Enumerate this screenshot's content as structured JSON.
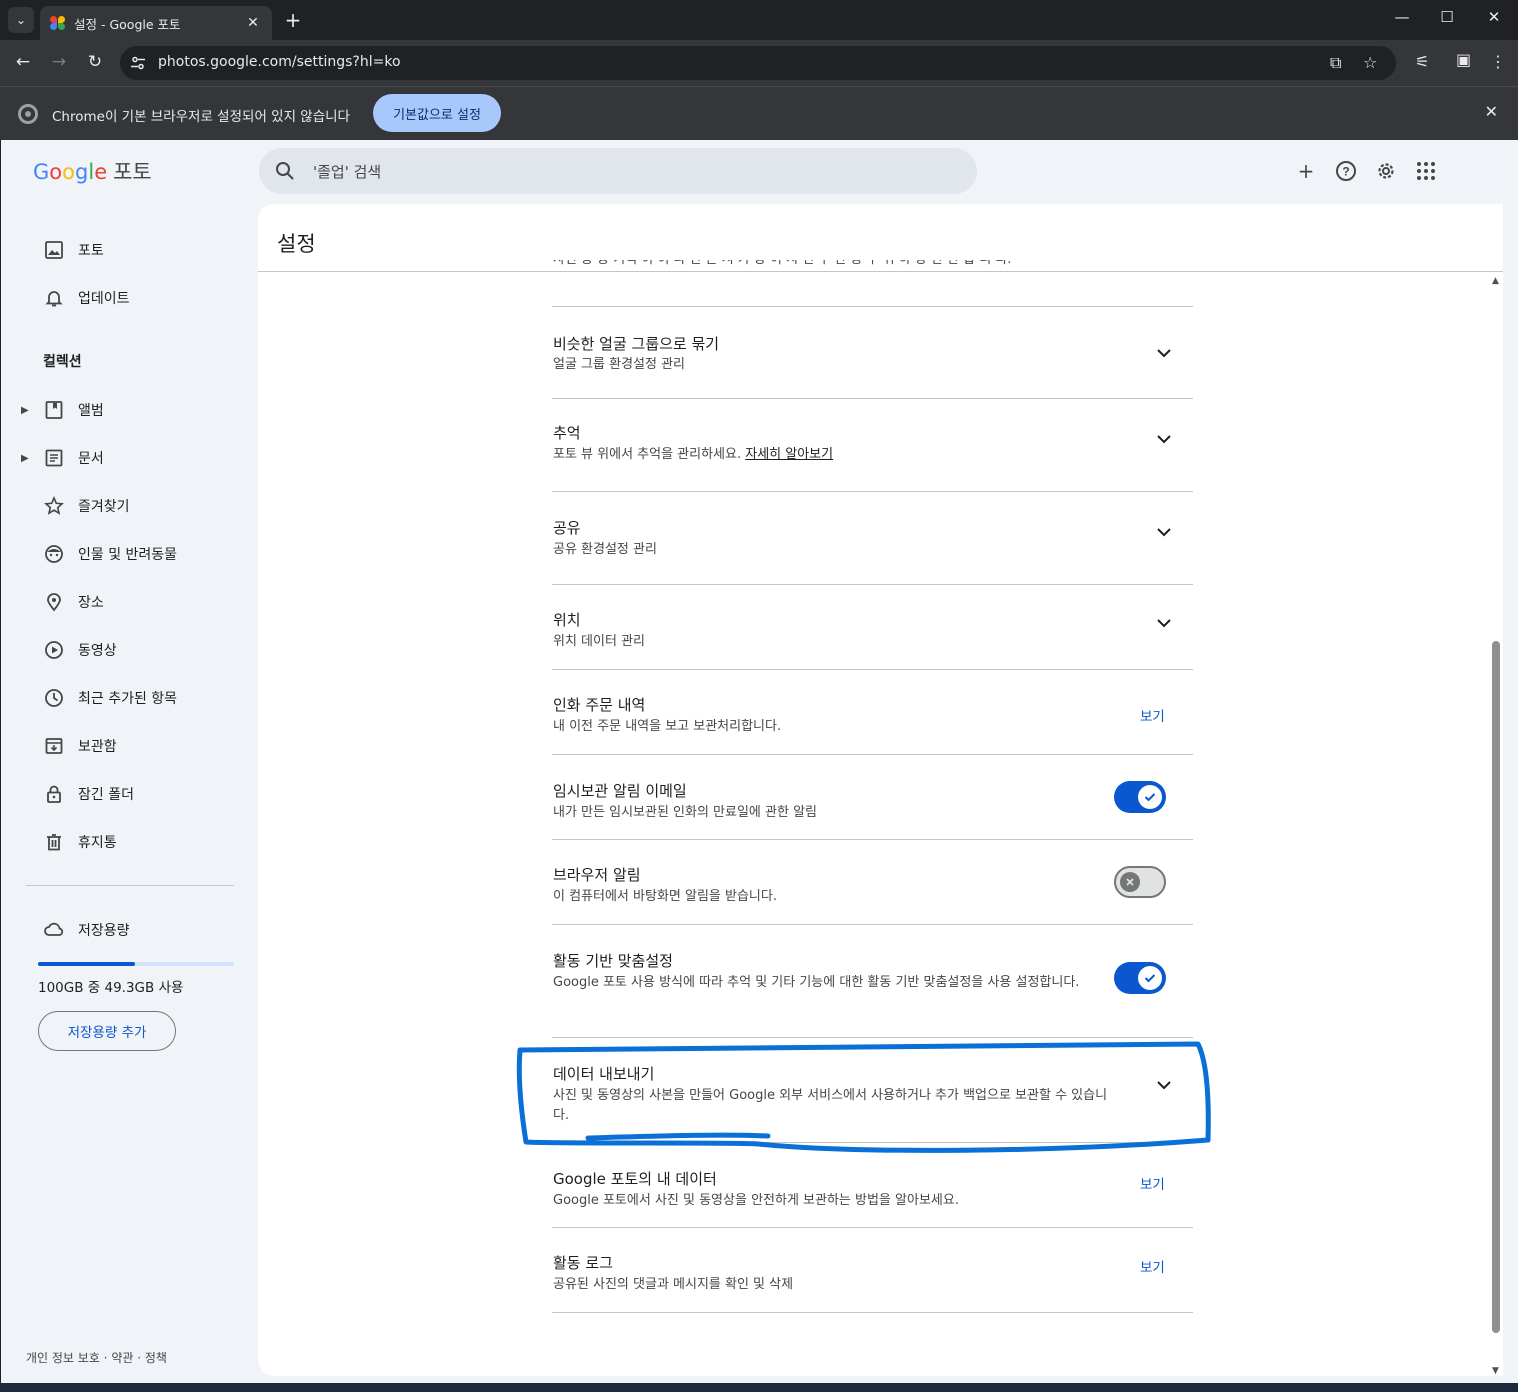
{
  "browser": {
    "tab_title": "설정 - Google 포토",
    "new_tab": "+",
    "url": "photos.google.com/settings?hl=ko",
    "infobar_message": "Chrome이 기본 브라우저로 설정되어 있지 않습니다",
    "infobar_button": "기본값으로 설정"
  },
  "app": {
    "logo_google": [
      "G",
      "o",
      "o",
      "g",
      "l",
      "e"
    ],
    "logo_product": "포토",
    "search_placeholder": "'졸업' 검색"
  },
  "sidebar": {
    "items": [
      {
        "label": "포토",
        "icon": "photo-icon"
      },
      {
        "label": "업데이트",
        "icon": "bell-icon"
      }
    ],
    "collections_heading": "컬렉션",
    "collections": [
      {
        "label": "앨범",
        "icon": "album-icon"
      },
      {
        "label": "문서",
        "icon": "document-icon"
      },
      {
        "label": "즐겨찾기",
        "icon": "star-icon"
      },
      {
        "label": "인물 및 반려동물",
        "icon": "face-icon"
      },
      {
        "label": "장소",
        "icon": "location-icon"
      },
      {
        "label": "동영상",
        "icon": "play-icon"
      },
      {
        "label": "최근 추가된 항목",
        "icon": "clock-icon"
      },
      {
        "label": "보관함",
        "icon": "archive-icon"
      },
      {
        "label": "잠긴 폴더",
        "icon": "lock-icon"
      },
      {
        "label": "휴지통",
        "icon": "trash-icon"
      }
    ],
    "storage": {
      "label": "저장용량",
      "usage_text": "100GB 중 49.3GB 사용",
      "used_fraction": 0.493,
      "button": "저장용량 추가"
    },
    "footer": "개인 정보 보호 · 약관 · 정책"
  },
  "settings": {
    "title": "설정",
    "cut_text": "사진 중 등 기억 이 이 나 만 는 시 가 당 이 시 면 우 만 증 수 위 하 당 만 한 합 니 다.",
    "rows": [
      {
        "title": "비슷한 얼굴 그룹으로 묶기",
        "desc": "얼굴 그룹 환경설정 관리",
        "control": "chevron"
      },
      {
        "title": "추억",
        "desc": "포토 뷰 위에서 추억을 관리하세요.",
        "link": "자세히 알아보기",
        "control": "chevron"
      },
      {
        "title": "공유",
        "desc": "공유 환경설정 관리",
        "control": "chevron"
      },
      {
        "title": "위치",
        "desc": "위치 데이터 관리",
        "control": "chevron"
      },
      {
        "title": "인화 주문 내역",
        "desc": "내 이전 주문 내역을 보고 보관처리합니다.",
        "control": "view",
        "view_label": "보기"
      },
      {
        "title": "임시보관 알림 이메일",
        "desc": "내가 만든 임시보관된 인화의 만료일에 관한 알림",
        "control": "toggle",
        "on": true
      },
      {
        "title": "브라우저 알림",
        "desc": "이 컴퓨터에서 바탕화면 알림을 받습니다.",
        "control": "toggle",
        "on": false
      },
      {
        "title": "활동 기반 맞춤설정",
        "desc": "Google 포토 사용 방식에 따라 추억 및 기타 기능에 대한 활동 기반 맞춤설정을 사용 설정합니다.",
        "control": "toggle",
        "on": true
      },
      {
        "title": "데이터 내보내기",
        "desc": "사진 및 동영상의 사본을 만들어 Google 외부 서비스에서 사용하거나 추가 백업으로 보관할 수 있습니다.",
        "control": "chevron"
      },
      {
        "title": "Google 포토의 내 데이터",
        "desc": "Google 포토에서 사진 및 동영상을 안전하게 보관하는 방법을 알아보세요.",
        "control": "view",
        "view_label": "보기"
      },
      {
        "title": "활동 로그",
        "desc": "공유된 사진의 댓글과 메시지를 확인 및 삭제",
        "control": "view",
        "view_label": "보기"
      }
    ]
  },
  "colors": {
    "accent": "#0b57d0",
    "annotation": "#0a6fd6"
  }
}
